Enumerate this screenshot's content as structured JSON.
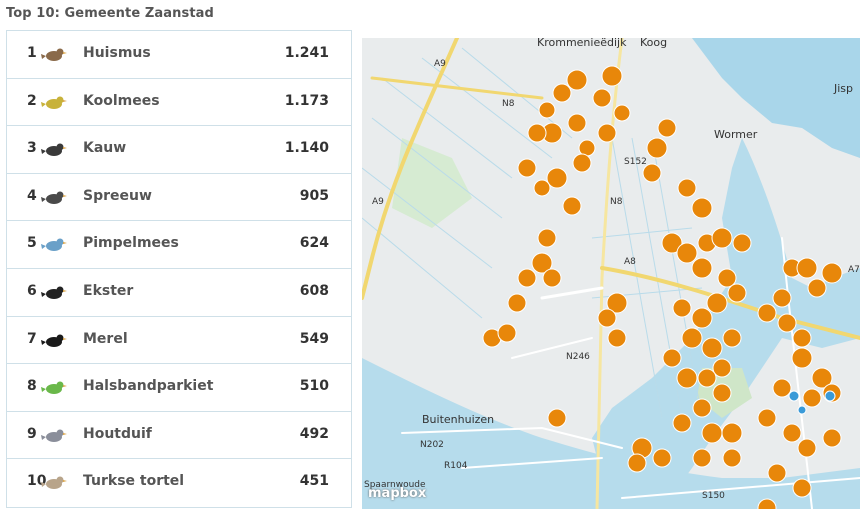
{
  "title": "Top 10: Gemeente Zaanstad",
  "rows": [
    {
      "rank": "1",
      "name": "Huismus",
      "count": "1.241",
      "color": "#8a6a4a"
    },
    {
      "rank": "2",
      "name": "Koolmees",
      "count": "1.173",
      "color": "#c8b23a"
    },
    {
      "rank": "3",
      "name": "Kauw",
      "count": "1.140",
      "color": "#3a3a3a"
    },
    {
      "rank": "4",
      "name": "Spreeuw",
      "count": "905",
      "color": "#4a4a4a"
    },
    {
      "rank": "5",
      "name": "Pimpelmees",
      "count": "624",
      "color": "#6aa0c8"
    },
    {
      "rank": "6",
      "name": "Ekster",
      "count": "608",
      "color": "#222222"
    },
    {
      "rank": "7",
      "name": "Merel",
      "count": "549",
      "color": "#1a1a1a"
    },
    {
      "rank": "8",
      "name": "Halsbandparkiet",
      "count": "510",
      "color": "#6ab84a"
    },
    {
      "rank": "9",
      "name": "Houtduif",
      "count": "492",
      "color": "#8a8e9a"
    },
    {
      "rank": "10",
      "name": "Turkse tortel",
      "count": "451",
      "color": "#b8a48a"
    }
  ],
  "map": {
    "labels": {
      "krommenie": "Krommenieëdijk",
      "koog": "Koog",
      "wormer": "Wormer",
      "jisp": "Jisp",
      "buitenhuizen": "Buitenhuizen",
      "a9": "A9",
      "a9b": "A9",
      "n8": "N8",
      "n8b": "N8",
      "s152": "S152",
      "a8": "A8",
      "a7": "A7",
      "n246": "N246",
      "n202": "N202",
      "r104": "R104",
      "s150": "S150",
      "spaarnwoude": "Spaarnwoude"
    },
    "attribution": "mapbox",
    "marker_color": "#e8870a",
    "marker_color_alt": "#3a9ad8"
  }
}
